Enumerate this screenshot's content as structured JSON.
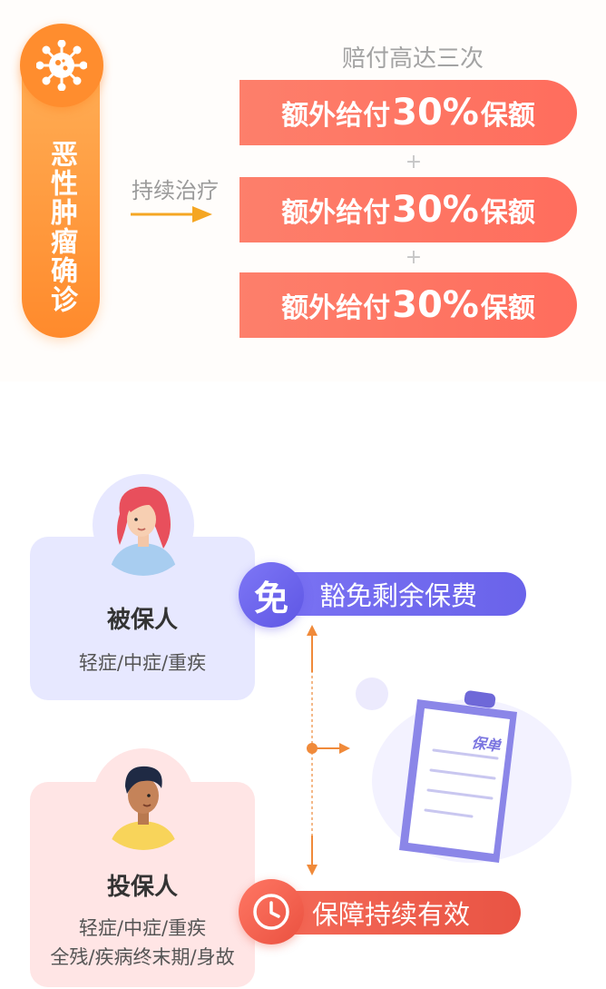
{
  "diagnosis": {
    "label": "恶性肿瘤确诊",
    "icon": "virus-icon"
  },
  "treatment": {
    "label": "持续治疗"
  },
  "payout": {
    "title": "赔付高达三次",
    "bars": [
      {
        "prefix": "额外给付",
        "number": "30%",
        "suffix": "保额"
      },
      {
        "prefix": "额外给付",
        "number": "30%",
        "suffix": "保额"
      },
      {
        "prefix": "额外给付",
        "number": "30%",
        "suffix": "保额"
      }
    ],
    "plus": "+"
  },
  "insured": {
    "title": "被保人",
    "conditions": "轻症/中症/重疾"
  },
  "policyholder": {
    "title": "投保人",
    "conditions_line1": "轻症/中症/重疾",
    "conditions_line2": "全残/疾病终末期/身故"
  },
  "waiver": {
    "badge": "免",
    "label": "豁免剩余保费"
  },
  "validity": {
    "label": "保障持续有效",
    "icon": "clock-icon"
  },
  "policy_doc": {
    "label": "保单"
  },
  "colors": {
    "orange": "#ff8a2c",
    "coral": "#ff6d5d",
    "purple": "#6a63ea",
    "red": "#e95444",
    "lavender": "#e7e8ff",
    "pink": "#ffe5e5"
  }
}
